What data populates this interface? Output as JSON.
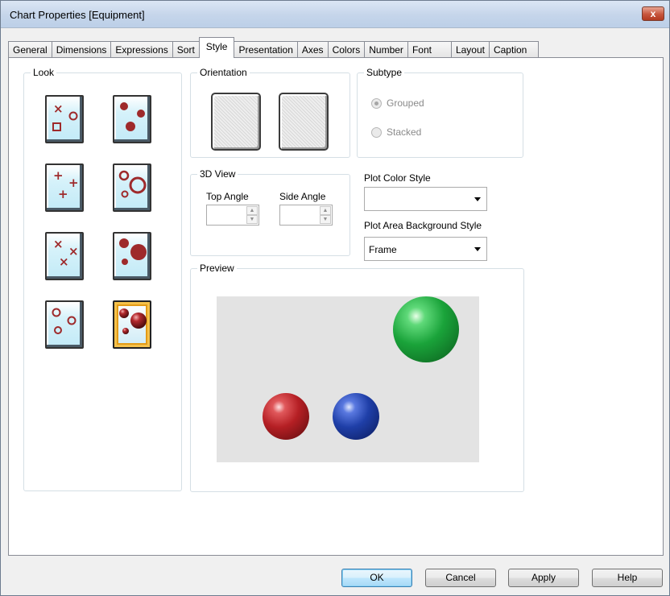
{
  "window": {
    "title": "Chart Properties [Equipment]",
    "close_label": "x"
  },
  "tabs": [
    {
      "label": "General"
    },
    {
      "label": "Dimensions"
    },
    {
      "label": "Expressions"
    },
    {
      "label": "Sort"
    },
    {
      "label": "Style",
      "active": true
    },
    {
      "label": "Presentation"
    },
    {
      "label": "Axes"
    },
    {
      "label": "Colors"
    },
    {
      "label": "Number"
    },
    {
      "label": "Font"
    },
    {
      "label": "Layout"
    },
    {
      "label": "Caption"
    }
  ],
  "look": {
    "label": "Look",
    "options": [
      {
        "name": "cross-circle-square"
      },
      {
        "name": "filled-dots"
      },
      {
        "name": "plus-markers"
      },
      {
        "name": "rings"
      },
      {
        "name": "x-markers"
      },
      {
        "name": "large-filled-dots"
      },
      {
        "name": "small-rings"
      },
      {
        "name": "3d-spheres",
        "selected": true
      }
    ]
  },
  "orientation": {
    "label": "Orientation"
  },
  "subtype": {
    "label": "Subtype",
    "grouped": "Grouped",
    "stacked": "Stacked",
    "selected": "Grouped"
  },
  "view3d": {
    "label": "3D View",
    "top_angle": "Top Angle",
    "side_angle": "Side Angle",
    "top_value": "",
    "side_value": ""
  },
  "plot_color_style": {
    "label": "Plot Color Style",
    "value": ""
  },
  "plot_bg_style": {
    "label": "Plot Area Background Style",
    "value": "Frame"
  },
  "preview": {
    "label": "Preview",
    "spheres": [
      {
        "color": "green"
      },
      {
        "color": "red"
      },
      {
        "color": "blue"
      }
    ]
  },
  "buttons": {
    "ok": "OK",
    "cancel": "Cancel",
    "apply": "Apply",
    "help": "Help"
  },
  "colors": {
    "marker": "#9e2a2b",
    "selected_border": "#e39b16",
    "sphere_green": "#1aa33a",
    "sphere_red": "#b51f24",
    "sphere_blue": "#1f3fa8"
  }
}
